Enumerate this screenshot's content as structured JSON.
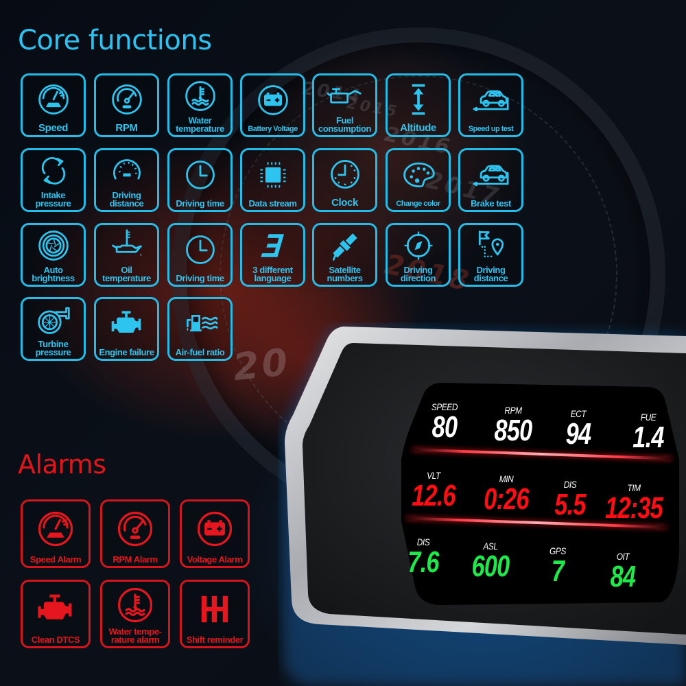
{
  "core_functions": {
    "title": "Core functions",
    "items": [
      {
        "label": "Speed",
        "icon": "speedometer-icon"
      },
      {
        "label": "RPM",
        "icon": "tachometer-icon"
      },
      {
        "label": "Water\ntemperature",
        "icon": "water-temperature-icon"
      },
      {
        "label": "Battery Voltage",
        "icon": "battery-icon"
      },
      {
        "label": "Fuel\nconsumption",
        "icon": "oil-can-icon"
      },
      {
        "label": "Altitude",
        "icon": "altitude-arrow-icon"
      },
      {
        "label": "Speed up test",
        "icon": "car-icon"
      },
      {
        "label": "Intake\npressure",
        "icon": "recycle-arrows-icon"
      },
      {
        "label": "Driving\ndistance",
        "icon": "odometer-icon"
      },
      {
        "label": "Driving time",
        "icon": "clock-icon"
      },
      {
        "label": "Data stream",
        "icon": "chip-icon"
      },
      {
        "label": "Clock",
        "icon": "clock-dots-icon"
      },
      {
        "label": "Change color",
        "icon": "palette-icon"
      },
      {
        "label": "Brake test",
        "icon": "car-icon"
      },
      {
        "label": "Auto\nbrightness",
        "icon": "aperture-icon"
      },
      {
        "label": "Oil\ntemperature",
        "icon": "oil-temperature-icon"
      },
      {
        "label": "Driving time",
        "icon": "clock-icon"
      },
      {
        "label": "3 different\nlanguage",
        "icon": "number-three-icon"
      },
      {
        "label": "Satellite\nnumbers",
        "icon": "satellite-icon"
      },
      {
        "label": "Driving\ndirection",
        "icon": "compass-icon"
      },
      {
        "label": "Driving\ndistance",
        "icon": "flag-pin-icon"
      },
      {
        "label": "Turbine\npressure",
        "icon": "turbo-icon"
      },
      {
        "label": "Engine failure",
        "icon": "engine-icon"
      },
      {
        "label": "Air-fuel ratio",
        "icon": "fuel-air-icon"
      }
    ]
  },
  "alarms": {
    "title": "Alarms",
    "items": [
      {
        "label": "Speed Alarm",
        "icon": "speedometer-icon"
      },
      {
        "label": "RPM Alarm",
        "icon": "tachometer-icon"
      },
      {
        "label": "Voltage Alarm",
        "icon": "battery-icon"
      },
      {
        "label": "Clean DTCS",
        "icon": "engine-icon"
      },
      {
        "label": "Water tempe-\nrature alarm",
        "icon": "water-temperature-icon"
      },
      {
        "label": "Shift reminder",
        "icon": "gear-shift-icon"
      }
    ]
  },
  "hud_display": {
    "rows": [
      {
        "color": "white",
        "cells": [
          {
            "label": "SPEED",
            "value": "80"
          },
          {
            "label": "RPM",
            "value": "850"
          },
          {
            "label": "ECT",
            "value": "94"
          },
          {
            "label": "FUE",
            "value": "1.4"
          }
        ]
      },
      {
        "color": "red",
        "cells": [
          {
            "label": "VLT",
            "value": "12.6"
          },
          {
            "label": "MIN",
            "value": "0:26"
          },
          {
            "label": "DIS",
            "value": "5.5"
          },
          {
            "label": "TIM",
            "value": "12:35"
          }
        ]
      },
      {
        "color": "green",
        "cells": [
          {
            "label": "DIS",
            "value": "7.6"
          },
          {
            "label": "ASL",
            "value": "600"
          },
          {
            "label": "GPS",
            "value": "7"
          },
          {
            "label": "OIT",
            "value": "84"
          }
        ]
      }
    ]
  },
  "background": {
    "years": [
      "2014",
      "2015",
      "2016",
      "2017",
      "2018",
      "20"
    ]
  },
  "colors": {
    "core_accent": "#22bde9",
    "alarm_accent": "#d5151c",
    "hud_white": "#ffffff",
    "hud_red": "#ff0d12",
    "hud_green": "#1ee84a"
  }
}
